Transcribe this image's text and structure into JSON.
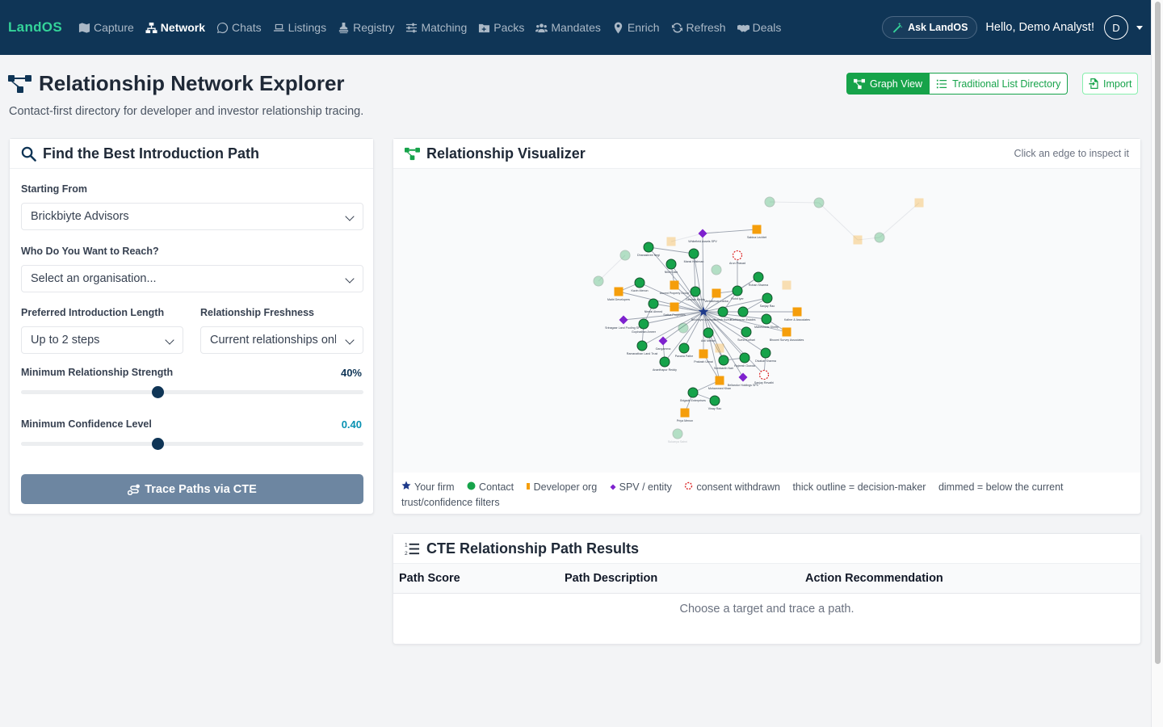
{
  "app": {
    "brand": "LandOS"
  },
  "nav": {
    "items": [
      {
        "label": "Capture",
        "icon": "map-icon"
      },
      {
        "label": "Network",
        "icon": "network-icon",
        "active": true
      },
      {
        "label": "Chats",
        "icon": "whatsapp-icon"
      },
      {
        "label": "Listings",
        "icon": "laptop-icon"
      },
      {
        "label": "Registry",
        "icon": "stamp-icon"
      },
      {
        "label": "Matching",
        "icon": "sliders-icon"
      },
      {
        "label": "Packs",
        "icon": "folder-plus-icon"
      },
      {
        "label": "Mandates",
        "icon": "users-icon"
      },
      {
        "label": "Enrich",
        "icon": "map-pin-icon"
      },
      {
        "label": "Refresh",
        "icon": "refresh-icon"
      },
      {
        "label": "Deals",
        "icon": "handshake-icon"
      }
    ],
    "ask_label": "Ask LandOS",
    "greeting": "Hello, Demo Analyst!",
    "avatar_initial": "D"
  },
  "page": {
    "title": "Relationship Network Explorer",
    "subtitle": "Contact-first directory for developer and investor relationship tracing."
  },
  "view_toggle": {
    "graph_label": "Graph View",
    "list_label": "Traditional List Directory",
    "import_label": "Import"
  },
  "finder": {
    "title": "Find the Best Introduction Path",
    "starting_label": "Starting From",
    "starting_value": "Brickbiyte Advisors",
    "reach_label": "Who Do You Want to Reach?",
    "reach_placeholder": "Select an organisation...",
    "length_label": "Preferred Introduction Length",
    "length_value": "Up to 2 steps",
    "freshness_label": "Relationship Freshness",
    "freshness_value": "Current relationships only",
    "strength_label": "Minimum Relationship Strength",
    "strength_value": "40%",
    "strength_fraction": 0.4,
    "confidence_label": "Minimum Confidence Level",
    "confidence_value": "0.40",
    "confidence_fraction": 0.4,
    "trace_label": "Trace Paths via CTE"
  },
  "visualizer": {
    "title": "Relationship Visualizer",
    "hint": "Click an edge to inspect it",
    "legend": {
      "your_firm": "Your firm",
      "contact": "Contact",
      "developer": "Developer org",
      "spv": "SPV / entity",
      "consent": "consent withdrawn",
      "thick": "thick outline = decision-maker",
      "dimmed": "dimmed = below the current trust/confidence filters"
    },
    "colors": {
      "contact": "#16a34a",
      "developer": "#f59e0b",
      "spv": "#7e22ce",
      "firm": "#1e3a8a",
      "consent": "#dc2626"
    },
    "node_labels": [
      "Sabina Lechtet",
      "Whitefield Assets SPV",
      "Dhanashree Negi",
      "Mansi Krishnan",
      "Arun Prasad",
      "Nikhil Jain",
      "Rohan Sharma",
      "Kavin Menon",
      "Ascent Property Group",
      "Deepak Mehta",
      "Venkatesan Lanka",
      "Rohit Iyer",
      "Maitri Developers",
      "Sanjay Rao",
      "Nirmal Ahmed",
      "Brickbiyte Advisors",
      "Suresh Kumar",
      "Kadhiravan Estates",
      "Sattva Properties",
      "Kalher & Associates",
      "Srinagaar Land Pooling SPV",
      "Gopinathan Ameer",
      "Maheshwar Shetty",
      "Sumo Kothari",
      "Bhoomi Survey Associates",
      "Ramanathan Land Trust",
      "Anil Menon",
      "Gangamma",
      "Pavana Pathe",
      "Prakash Unnai",
      "Sreekanth Nair",
      "Rajeesh Gowda",
      "Divakar Sharma",
      "Ananthapur Reddy",
      "Mohammed Khan",
      "Bellandur Holdings SPV",
      "Sanjay Revathi",
      "Brigade Enterprises",
      "Priya Menon",
      "Vinay Rao",
      "Sukanya Sahni"
    ],
    "empty_result": "Choose a target and trace a path."
  },
  "results": {
    "title": "CTE Relationship Path Results",
    "columns": [
      "Path Score",
      "Path Description",
      "Action Recommendation"
    ],
    "empty": "Choose a target and trace a path."
  }
}
